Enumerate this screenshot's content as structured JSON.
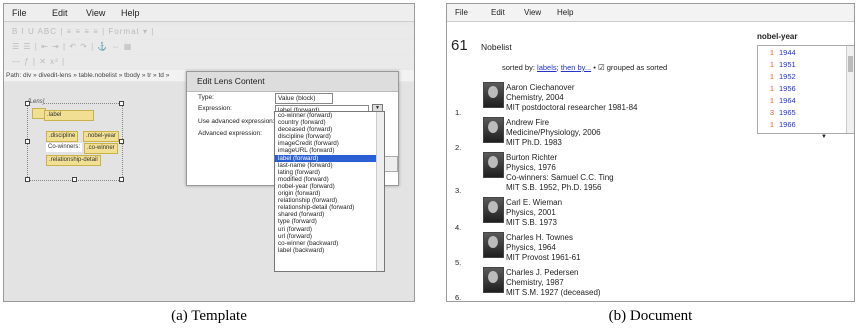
{
  "template": {
    "menu": [
      "File",
      "Edit",
      "View",
      "Help"
    ],
    "toolbar_rows": [
      "B  I  U  ABC |  ≡  ≡  ≡  ≡  | Format  ▾ |",
      "☰  ☰  |  ⇤  ⇥  |  ↶  ↷  |  ⚓  ⇔  ▦",
      "—  ƒ  |  ✕  x²  |"
    ],
    "path": "Path: div » divedit-lens » table.nobelist » tbody » tr » td »",
    "lens_label": "[Lens]",
    "items": {
      "label": ".label",
      "discipline": ".discipline",
      "nobel_year": ".nobel-year",
      "co_winners_text": "Co-winners:",
      "co_winner": ".co-winner",
      "relationship_detail": ".relationship-detail"
    },
    "dialog": {
      "title": "Edit Lens Content",
      "type_label": "Type:",
      "type_value": "Value (block)",
      "expr_label": "Expression:",
      "expr_value": "label (forward)",
      "use_adv_label": "Use advanced expression:",
      "adv_label": "Advanced expression:"
    },
    "list_options": [
      "co-winner (forward)",
      "country (forward)",
      "deceased (forward)",
      "discipline (forward)",
      "imageCredit (forward)",
      "imageURL (forward)",
      "label (forward)",
      "last-name (forward)",
      "lating (forward)",
      "modified (forward)",
      "nobel-year (forward)",
      "origin (forward)",
      "relationship (forward)",
      "relationship-detail (forward)",
      "shared (forward)",
      "type (forward)",
      "uri (forward)",
      "url (forward)",
      "co-winner (backward)",
      "label (backward)"
    ],
    "selected_option": "label (forward)",
    "caption": "(a) Template"
  },
  "document": {
    "menu": [
      "File",
      "Edit",
      "View",
      "Help"
    ],
    "count": "61",
    "collection": "Nobelist",
    "sorted_prefix": "sorted by:",
    "sorted_labels": "labels",
    "sorted_then": "then by...",
    "sorted_suffix": "•",
    "grouped": "☑ grouped as sorted",
    "people": [
      {
        "num": "1.",
        "lines": [
          "Aaron Ciechanover",
          "Chemistry, 2004",
          "MIT postdoctoral researcher 1981-84"
        ]
      },
      {
        "num": "2.",
        "lines": [
          "Andrew Fire",
          "Medicine/Physiology, 2006",
          "MIT Ph.D. 1983"
        ]
      },
      {
        "num": "3.",
        "lines": [
          "Burton Richter",
          "Physics, 1976",
          "Co-winners: Samuel C.C. Ting",
          "MIT S.B. 1952, Ph.D. 1956"
        ]
      },
      {
        "num": "4.",
        "lines": [
          "Carl E. Wieman",
          "Physics, 2001",
          "MIT S.B. 1973"
        ]
      },
      {
        "num": "5.",
        "lines": [
          "Charles H. Townes",
          "Physics, 1964",
          "MIT Provost 1961-61"
        ]
      },
      {
        "num": "6.",
        "lines": [
          "Charles J. Pedersen",
          "Chemistry, 1987",
          "MIT S.M. 1927 (deceased)"
        ]
      }
    ],
    "facet": {
      "title": "nobel-year",
      "rows": [
        {
          "count": "1",
          "value": "1944"
        },
        {
          "count": "1",
          "value": "1951"
        },
        {
          "count": "1",
          "value": "1952"
        },
        {
          "count": "1",
          "value": "1956"
        },
        {
          "count": "1",
          "value": "1964"
        },
        {
          "count": "3",
          "value": "1965"
        },
        {
          "count": "1",
          "value": "1966"
        }
      ]
    },
    "caption": "(b) Document"
  }
}
